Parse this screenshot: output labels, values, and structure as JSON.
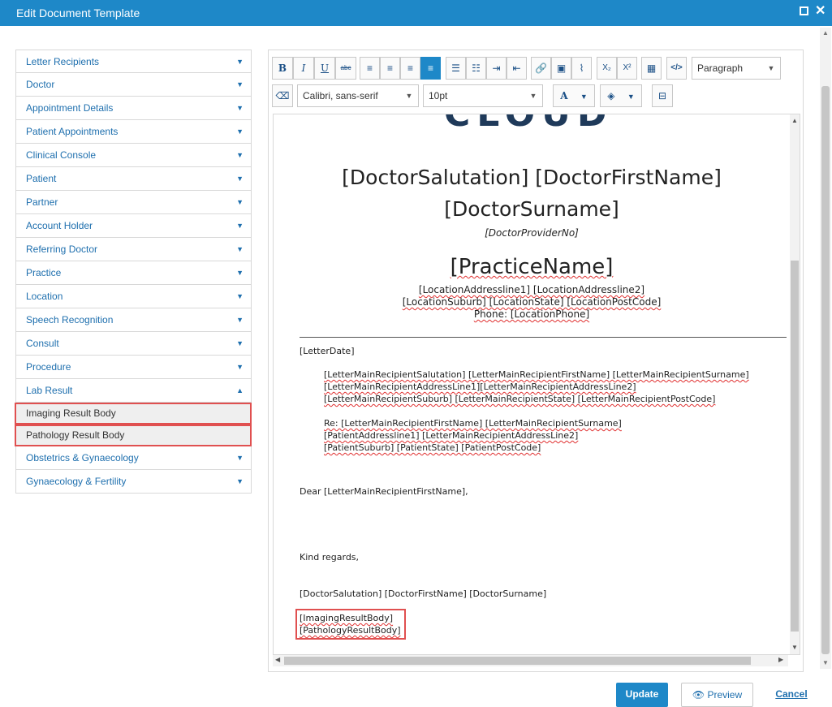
{
  "window": {
    "title": "Edit Document Template"
  },
  "sidebar": {
    "items": [
      {
        "label": "Letter Recipients"
      },
      {
        "label": "Doctor"
      },
      {
        "label": "Appointment Details"
      },
      {
        "label": "Patient Appointments"
      },
      {
        "label": "Clinical Console"
      },
      {
        "label": "Patient"
      },
      {
        "label": "Partner"
      },
      {
        "label": "Account Holder"
      },
      {
        "label": "Referring Doctor"
      },
      {
        "label": "Practice"
      },
      {
        "label": "Location"
      },
      {
        "label": "Speech Recognition"
      },
      {
        "label": "Consult"
      },
      {
        "label": "Procedure"
      },
      {
        "label": "Lab Result"
      }
    ],
    "lab_result_children": [
      "Imaging Result Body",
      "Pathology Result Body"
    ],
    "items_after": [
      {
        "label": "Obstetrics & Gynaecology"
      },
      {
        "label": "Gynaecology & Fertility"
      }
    ]
  },
  "toolbar": {
    "bold": "B",
    "italic": "I",
    "underline": "U",
    "strike": "abc",
    "format_select": "Paragraph",
    "font_select": "Calibri, sans-serif",
    "size_select": "10pt",
    "font_color": "A",
    "subscript": "X₂",
    "superscript": "X²",
    "code": "</>"
  },
  "document": {
    "logo": "CLOUD",
    "doctor_line1": "[DoctorSalutation] [DoctorFirstName]",
    "doctor_line2": "[DoctorSurname]",
    "provider_no": "[DoctorProviderNo]",
    "practice_name": "[PracticeName]",
    "loc_line1": "[LocationAddressline1] [LocationAddressline2]",
    "loc_line2": "[LocationSuburb] [LocationState] [LocationPostCode]",
    "phone_line": "Phone: [LocationPhone]",
    "letter_date": "[LetterDate]",
    "recip1": "[LetterMainRecipientSalutation] [LetterMainRecipientFirstName] [LetterMainRecipientSurname]",
    "recip2": "[LetterMainRecipientAddressLine1][LetterMainRecipientAddressLine2]",
    "recip3": "[LetterMainRecipientSuburb] [LetterMainRecipientState] [LetterMainRecipientPostCode]",
    "re1": "Re: [LetterMainRecipientFirstName] [LetterMainRecipientSurname]",
    "re2": "[PatientAddressline1] [LetterMainRecipientAddressLine2]",
    "re3": "[PatientSuburb] [PatientState] [PatientPostCode]",
    "dear": "Dear [LetterMainRecipientFirstName],",
    "regards": "Kind regards,",
    "signoff": "[DoctorSalutation] [DoctorFirstName] [DoctorSurname]",
    "imaging": "[ImagingResultBody]",
    "pathology": "[PathologyResultBody]"
  },
  "footer": {
    "update": "Update",
    "preview": "Preview",
    "cancel": "Cancel"
  },
  "colors": {
    "accent": "#1e88c8",
    "highlight": "#e05050"
  }
}
